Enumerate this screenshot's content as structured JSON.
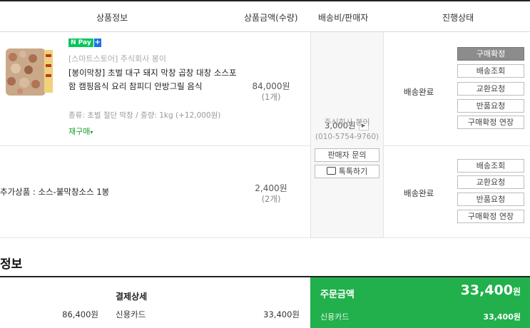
{
  "header": {
    "col_product": "상품정보",
    "col_amount": "상품금액(수량)",
    "col_shipping": "배송비/판매자",
    "col_status": "진행상태"
  },
  "item1": {
    "npay": "N Pay",
    "store": "[스마트스토어] 주식회사 봉이",
    "name": "[봉이막창] 초벌 대구 돼지 막창 곱창 대창 소스포함 캠핑음식 요리 참피디 안방그릴 음식",
    "option": "종류: 초벌 절단 막창 / 중량: 1kg (+12,000원)",
    "rebuy": "재구매",
    "price": "84,000원",
    "qty": "(1개)",
    "status": "배송완료",
    "buttons": [
      "구매확정",
      "배송조회",
      "교환요청",
      "반품요청",
      "구매확정 연장"
    ]
  },
  "shipping": {
    "fee": "3,000원",
    "seller": "주식회사 봉이",
    "phone": "(010-5754-9760)",
    "inquiry_button": "판매자 문의",
    "talk_button": "톡톡하기"
  },
  "item2": {
    "name": "추가상품 : 소스-불막창소스 1봉",
    "price": "2,400원",
    "qty": "(2개)",
    "status": "배송완료",
    "buttons": [
      "배송조회",
      "교환요청",
      "반품요청",
      "구매확정 연장"
    ]
  },
  "payment": {
    "section_title": "정보",
    "detail_title": "결제상세",
    "left_amount": "86,400원",
    "method_label": "신용카드",
    "method_amount": "33,400원",
    "order_label": "주문금액",
    "order_total": "33,400",
    "order_unit": "원",
    "card_label": "신용카드",
    "card_amount": "33,400원"
  },
  "colors": {
    "green": "#21b04b",
    "dark_button": "#8c8c8c"
  }
}
